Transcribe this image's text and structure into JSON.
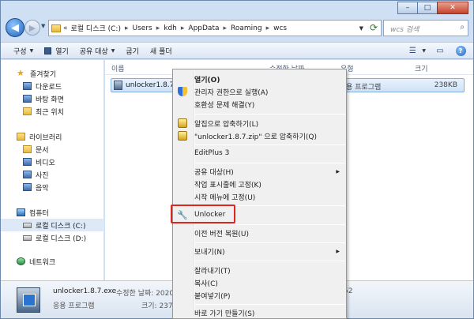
{
  "window": {
    "caption_buttons": [
      "–",
      "□",
      "✕"
    ]
  },
  "nav": {
    "back": "◀",
    "forward": "▶",
    "history": "▼",
    "address_chevron": "«",
    "breadcrumbs": [
      "로컬 디스크 (C:)",
      "Users",
      "kdh",
      "AppData",
      "Roaming",
      "wcs"
    ],
    "separator": "▸",
    "dropdown": "▼",
    "refresh": "⟳",
    "search_placeholder": "wcs 검색",
    "search_icon": "⌕"
  },
  "toolbar": {
    "organize": "구성",
    "open": "열기",
    "share": "공유 대상",
    "burn": "굽기",
    "new_folder": "새 폴더",
    "dropdown_arrow": "▼",
    "views_icon": "☰",
    "preview_icon": "▭",
    "help_icon": "?"
  },
  "navpane": {
    "favorites": "즐겨찾기",
    "downloads": "다운로드",
    "desktop": "바탕 화면",
    "recent": "최근 위치",
    "libraries": "라이브러리",
    "documents": "문서",
    "videos": "비디오",
    "pictures": "사진",
    "music": "음악",
    "computer": "컴퓨터",
    "drive_c": "로컬 디스크 (C:)",
    "drive_d": "로컬 디스크 (D:)",
    "network": "네트워크",
    "star": "★"
  },
  "content": {
    "columns": {
      "name": "이름",
      "modified": "수정한 날짜",
      "type": "유형",
      "size": "크기"
    },
    "file": {
      "name": "unlocker1.8.7.e",
      "type": "용 프로그램",
      "size": "238KB"
    }
  },
  "details": {
    "name": "unlocker1.8.7.exe",
    "type": "응용 프로그램",
    "modified": "수정한 날짜: 2020",
    "size": "크기: 237",
    "misc": "52"
  },
  "context_menu": {
    "open": "열기(O)",
    "run_as_admin": "관리자 권한으로 실행(A)",
    "troubleshoot": "호환성 문제 해결(Y)",
    "compress_alzip": "알집으로 압축하기(L)",
    "compress_named": "\"unlocker1.8.7.zip\" 으로 압축하기(Q)",
    "editplus": "EditPlus 3",
    "share_with": "공유 대상(H)",
    "pin_taskbar": "작업 표시줄에 고정(K)",
    "pin_start": "시작 메뉴에 고정(U)",
    "unlocker": "Unlocker",
    "restore": "이전 버전 복원(U)",
    "send_to": "보내기(N)",
    "cut": "잘라내기(T)",
    "copy": "복사(C)",
    "paste": "붙여넣기(P)",
    "create_shortcut": "바로 가기 만들기(S)",
    "submenu_arrow": "▶",
    "key_glyph": "🔧"
  }
}
